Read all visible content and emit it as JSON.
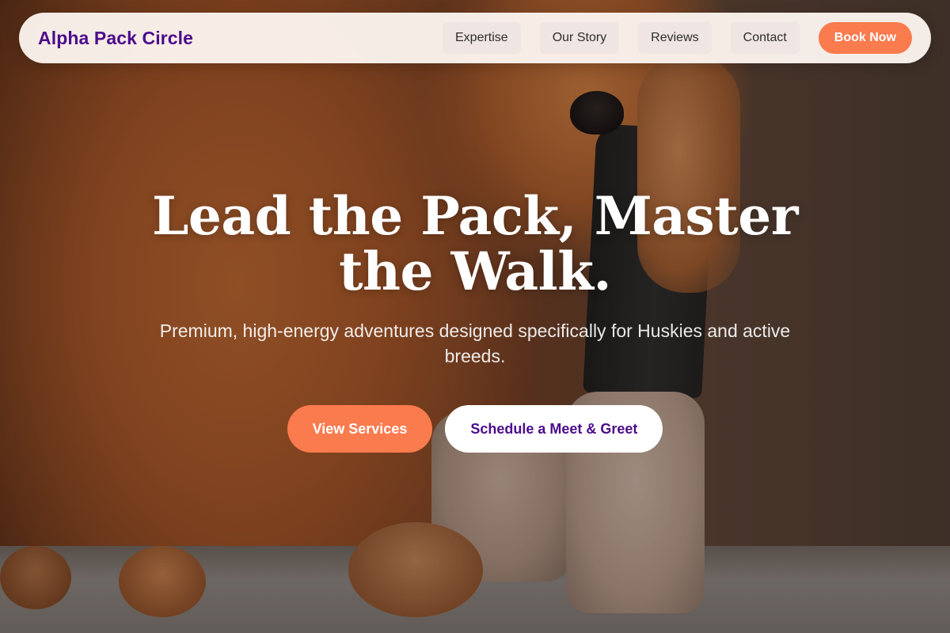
{
  "brand": {
    "name": "Alpha Pack Circle",
    "color": "#4b0c8c"
  },
  "nav": {
    "items": [
      {
        "label": "Expertise"
      },
      {
        "label": "Our Story"
      },
      {
        "label": "Reviews"
      },
      {
        "label": "Contact"
      }
    ],
    "cta_label": "Book Now"
  },
  "hero": {
    "title": "Lead the Pack, Master the Walk.",
    "subtitle": "Premium, high-energy adventures designed specifically for Huskies and active breeds.",
    "primary_button": "View Services",
    "secondary_button": "Schedule a Meet & Greet",
    "background_image": "dog-and-walker-photo"
  },
  "colors": {
    "accent": "#fa7b4e",
    "brand": "#4b0c8c",
    "nav_background": "#fcf4ee"
  }
}
